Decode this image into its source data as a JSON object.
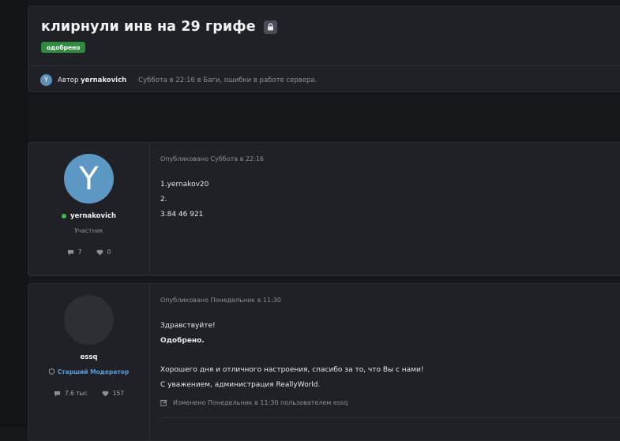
{
  "topic": {
    "title": "клирнули инв на 29 грифе",
    "badge": "одобрено",
    "author_avatar_letter": "Y",
    "author_prefix": "Автор",
    "author_name": "yernakovich",
    "meta_rest": "Суббота в 22:16 в Баги, ошибки в работе сервера."
  },
  "posts": [
    {
      "avatar_letter": "Y",
      "author": "yernakovich",
      "role": "Участник",
      "stats": {
        "comments": "7",
        "likes": "0"
      },
      "published": "Опубликовано Суббота в 22:16",
      "lines": [
        "1.yernakov20",
        "2.",
        "3.84 46 921"
      ]
    },
    {
      "avatar_letter": "",
      "author": "essq",
      "role": "Старший Модератор",
      "stats": {
        "comments": "7.6 тыс",
        "likes": "157"
      },
      "published": "Опубликовано Понедельник в 11:30",
      "lines": [
        "Здравствуйте!",
        "Одобрено.",
        "",
        "Хорошего дня и отличного настроения, спасибо за то, что Вы с нами!",
        "С уважением, администрация ReallyWorld."
      ],
      "edited": "Изменено Понедельник в 11:30 пользователем essq"
    }
  ],
  "colors": {
    "accent_green": "#2f8a3d",
    "online": "#3fb950",
    "moderator": "#5a9bd5",
    "avatar_blue": "#5d98c4"
  }
}
